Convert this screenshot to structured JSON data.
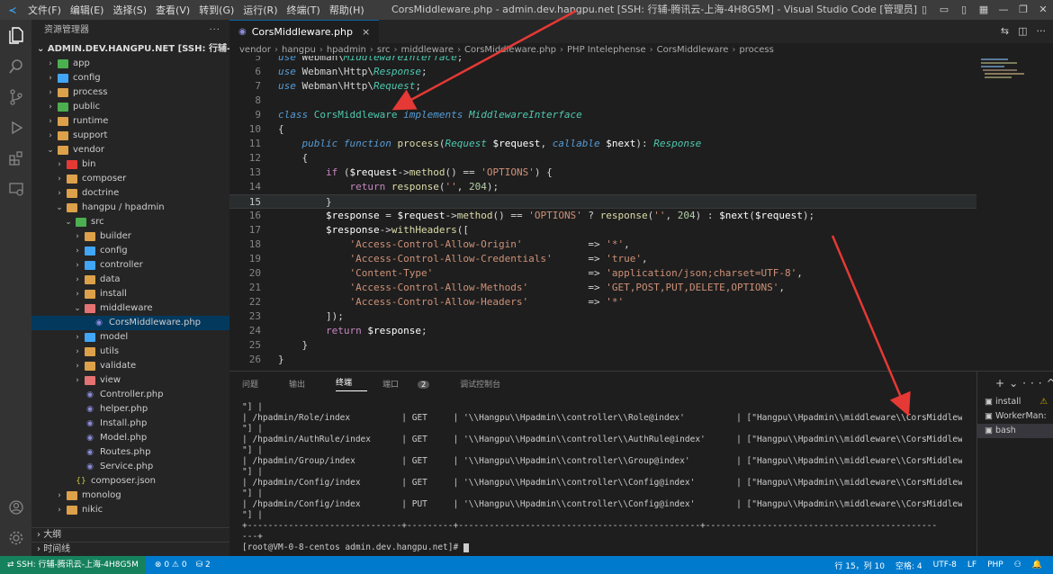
{
  "window": {
    "title": "CorsMiddleware.php - admin.dev.hangpu.net [SSH: 行辅-腾讯云-上海-4H8G5M] - Visual Studio Code [管理员]",
    "menu": [
      "文件(F)",
      "编辑(E)",
      "选择(S)",
      "查看(V)",
      "转到(G)",
      "运行(R)",
      "终端(T)",
      "帮助(H)"
    ]
  },
  "sidebar": {
    "header": "资源管理器",
    "root": "ADMIN.DEV.HANGPU.NET [SSH: 行辅-腾讯云-上海-4...",
    "items": [
      {
        "label": "app",
        "chev": ">",
        "level": 1,
        "color": "#4caf50"
      },
      {
        "label": "config",
        "chev": ">",
        "level": 1,
        "color": "#42a5f5"
      },
      {
        "label": "process",
        "chev": ">",
        "level": 1,
        "color": "#dca14a"
      },
      {
        "label": "public",
        "chev": ">",
        "level": 1,
        "color": "#4caf50"
      },
      {
        "label": "runtime",
        "chev": ">",
        "level": 1,
        "color": "#dca14a"
      },
      {
        "label": "support",
        "chev": ">",
        "level": 1,
        "color": "#dca14a"
      },
      {
        "label": "vendor",
        "chev": "v",
        "level": 1,
        "color": "#dca14a"
      },
      {
        "label": "bin",
        "chev": ">",
        "level": 2,
        "color": "#e53935"
      },
      {
        "label": "composer",
        "chev": ">",
        "level": 2,
        "color": "#dca14a"
      },
      {
        "label": "doctrine",
        "chev": ">",
        "level": 2,
        "color": "#dca14a"
      },
      {
        "label": "hangpu / hpadmin",
        "chev": "v",
        "level": 2,
        "color": "#dca14a"
      },
      {
        "label": "src",
        "chev": "v",
        "level": 3,
        "color": "#4caf50"
      },
      {
        "label": "builder",
        "chev": ">",
        "level": 4,
        "color": "#dca14a"
      },
      {
        "label": "config",
        "chev": ">",
        "level": 4,
        "color": "#42a5f5"
      },
      {
        "label": "controller",
        "chev": ">",
        "level": 4,
        "color": "#42a5f5"
      },
      {
        "label": "data",
        "chev": ">",
        "level": 4,
        "color": "#dca14a"
      },
      {
        "label": "install",
        "chev": ">",
        "level": 4,
        "color": "#dca14a"
      },
      {
        "label": "middleware",
        "chev": "v",
        "level": 4,
        "color": "#e57373"
      },
      {
        "label": "CorsMiddleware.php",
        "chev": "",
        "level": 5,
        "php": true,
        "active": true
      },
      {
        "label": "model",
        "chev": ">",
        "level": 4,
        "color": "#42a5f5"
      },
      {
        "label": "utils",
        "chev": ">",
        "level": 4,
        "color": "#dca14a"
      },
      {
        "label": "validate",
        "chev": ">",
        "level": 4,
        "color": "#dca14a"
      },
      {
        "label": "view",
        "chev": ">",
        "level": 4,
        "color": "#e57373"
      },
      {
        "label": "Controller.php",
        "chev": "",
        "level": 4,
        "php": true
      },
      {
        "label": "helper.php",
        "chev": "",
        "level": 4,
        "php": true
      },
      {
        "label": "Install.php",
        "chev": "",
        "level": 4,
        "php": true
      },
      {
        "label": "Model.php",
        "chev": "",
        "level": 4,
        "php": true
      },
      {
        "label": "Routes.php",
        "chev": "",
        "level": 4,
        "php": true
      },
      {
        "label": "Service.php",
        "chev": "",
        "level": 4,
        "php": true
      },
      {
        "label": "composer.json",
        "chev": "",
        "level": 3,
        "json": true
      },
      {
        "label": "monolog",
        "chev": ">",
        "level": 2,
        "color": "#dca14a"
      },
      {
        "label": "nikic",
        "chev": ">",
        "level": 2,
        "color": "#dca14a"
      }
    ],
    "outline": "大纲",
    "timeline": "时间线"
  },
  "tab": {
    "label": "CorsMiddleware.php",
    "close": "×"
  },
  "breadcrumb": [
    "vendor",
    "hangpu",
    "hpadmin",
    "src",
    "middleware",
    "CorsMiddleware.php",
    "PHP Intelephense",
    "CorsMiddleware",
    "process"
  ],
  "editor": {
    "current_line": 15,
    "lines": [
      {
        "n": "5",
        "t": "use Webman\\MiddlewareInterface;"
      },
      {
        "n": "6",
        "t": "use Webman\\Http\\Response;"
      },
      {
        "n": "7",
        "t": "use Webman\\Http\\Request;"
      },
      {
        "n": "8",
        "t": ""
      },
      {
        "n": "9",
        "t": "class CorsMiddleware implements MiddlewareInterface"
      },
      {
        "n": "10",
        "t": "{"
      },
      {
        "n": "11",
        "t": "    public function process(Request $request, callable $next): Response"
      },
      {
        "n": "12",
        "t": "    {"
      },
      {
        "n": "13",
        "t": "        if ($request->method() == 'OPTIONS') {"
      },
      {
        "n": "14",
        "t": "            return response('', 204);"
      },
      {
        "n": "15",
        "t": "        }"
      },
      {
        "n": "16",
        "t": "        $response = $request->method() == 'OPTIONS' ? response('', 204) : $next($request);"
      },
      {
        "n": "17",
        "t": "        $response->withHeaders(["
      },
      {
        "n": "18",
        "t": "            'Access-Control-Allow-Origin'           => '*',"
      },
      {
        "n": "19",
        "t": "            'Access-Control-Allow-Credentials'      => 'true',"
      },
      {
        "n": "20",
        "t": "            'Content-Type'                          => 'application/json;charset=UTF-8',"
      },
      {
        "n": "21",
        "t": "            'Access-Control-Allow-Methods'          => 'GET,POST,PUT,DELETE,OPTIONS',"
      },
      {
        "n": "22",
        "t": "            'Access-Control-Allow-Headers'          => '*'"
      },
      {
        "n": "23",
        "t": "        ]);"
      },
      {
        "n": "24",
        "t": "        return $response;"
      },
      {
        "n": "25",
        "t": "    }"
      },
      {
        "n": "26",
        "t": "}"
      }
    ]
  },
  "panel": {
    "tabs": [
      "问题",
      "输出",
      "终端",
      "端口",
      "调试控制台"
    ],
    "ports_badge": "2",
    "terminal_lines": [
      "\"] |",
      "| /hpadmin/Role/index          | GET     | '\\\\Hangpu\\\\Hpadmin\\\\controller\\\\Role@index'          | [\"Hangpu\\\\Hpadmin\\\\middleware\\\\CorsMiddleware",
      "\"] |",
      "| /hpadmin/AuthRule/index      | GET     | '\\\\Hangpu\\\\Hpadmin\\\\controller\\\\AuthRule@index'      | [\"Hangpu\\\\Hpadmin\\\\middleware\\\\CorsMiddleware",
      "\"] |",
      "| /hpadmin/Group/index         | GET     | '\\\\Hangpu\\\\Hpadmin\\\\controller\\\\Group@index'         | [\"Hangpu\\\\Hpadmin\\\\middleware\\\\CorsMiddleware",
      "\"] |",
      "| /hpadmin/Config/index        | GET     | '\\\\Hangpu\\\\Hpadmin\\\\controller\\\\Config@index'        | [\"Hangpu\\\\Hpadmin\\\\middleware\\\\CorsMiddleware",
      "\"] |",
      "| /hpadmin/Config/index        | PUT     | '\\\\Hangpu\\\\Hpadmin\\\\controller\\\\Config@index'        | [\"Hangpu\\\\Hpadmin\\\\middleware\\\\CorsMiddleware",
      "\"] |",
      "+------------------------------+---------+-----------------------------------------------+---------------------------------------------",
      "---+",
      "[root@VM-0-8-centos admin.dev.hangpu.net]# "
    ],
    "terminals": [
      {
        "label": "install",
        "warn": "⚠"
      },
      {
        "label": "WorkerMan:",
        "warn": ""
      },
      {
        "label": "bash",
        "warn": ""
      }
    ]
  },
  "statusbar": {
    "remote": "SSH: 行辅-腾讯云-上海-4H8G5M",
    "problems": "⊗ 0 ⚠ 0",
    "ports": "2",
    "position": "行 15，列 10",
    "spaces": "空格: 4",
    "encoding": "UTF-8",
    "eol": "LF",
    "language": "PHP"
  },
  "colors": {
    "statusbar": "#007acc",
    "remote": "#16825d",
    "arrow": "#e53935"
  }
}
